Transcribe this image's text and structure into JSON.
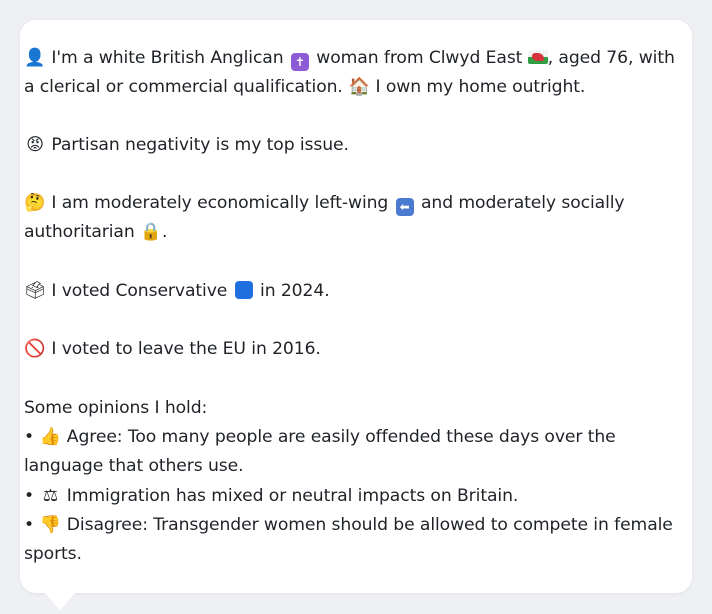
{
  "profile": {
    "line1a": "I'm a white British Anglican",
    "line1b": "woman from Clwyd East",
    "line1c": ", aged 76, with",
    "line2a": "a clerical or commercial qualification.",
    "line2b": "I own my home outright.",
    "issue": "Partisan negativity is my top issue.",
    "econ_a": "I am moderately economically left-wing",
    "econ_b": "and moderately socially",
    "econ_c": "authoritarian",
    "econ_d": ".",
    "vote_a": "I voted Conservative",
    "vote_b": "in 2024.",
    "eu": "I voted to leave the EU in 2016.",
    "opinions_heading": "Some opinions I hold:",
    "bullet": "•",
    "op1_a": "Agree: Too many people are easily offended these days over the",
    "op1_b": "language that others use.",
    "op2": "Immigration has mixed or neutral impacts on Britain.",
    "op3_a": "Disagree: Transgender women should be allowed to compete in female",
    "op3_b": "sports."
  },
  "icons": {
    "person": "👤",
    "cross": "✝",
    "house": "🏠",
    "angry": "😡",
    "thinking": "🤔",
    "left_arrow": "⬅",
    "lock": "🔒",
    "ballot": "🗳",
    "no_entry": "🚫",
    "thumbs_up": "👍",
    "scales": "⚖",
    "thumbs_down": "👎"
  },
  "colors": {
    "background": "#eef0f3",
    "bubble": "#ffffff",
    "text": "#1f2328",
    "cross_box": "#8e5bd6",
    "arrow_box": "#4a7bd1",
    "conservative_box": "#1f6fe0"
  }
}
